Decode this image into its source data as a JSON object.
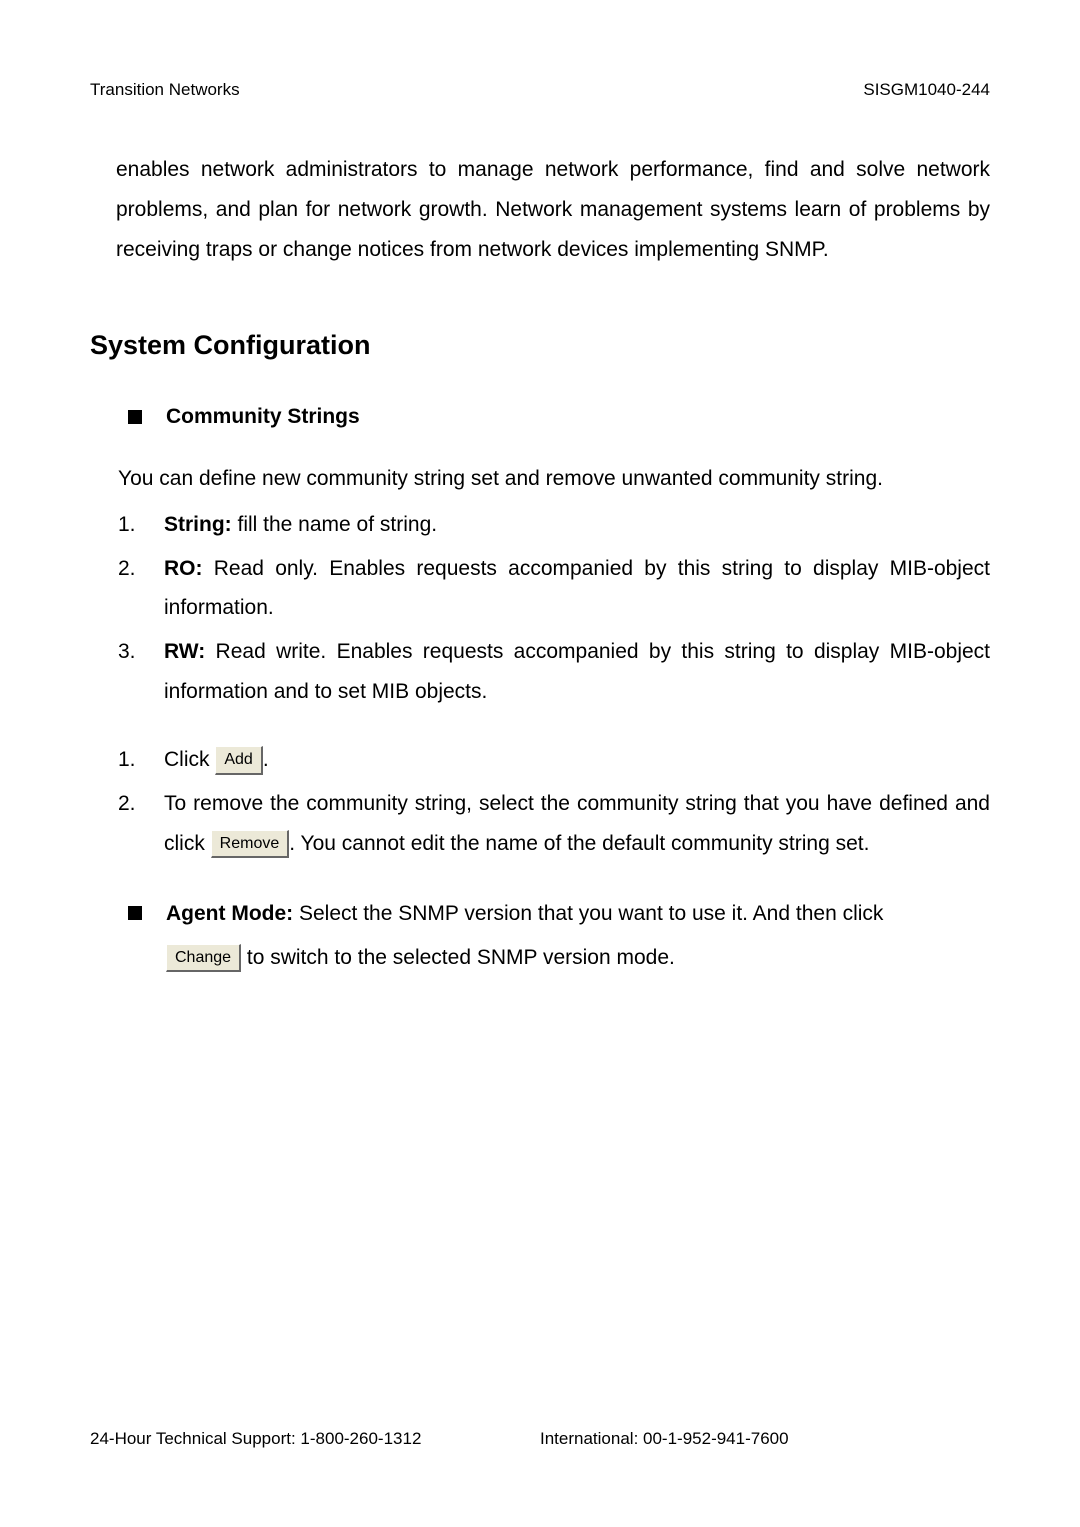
{
  "header": {
    "left": "Transition Networks",
    "right": "SISGM1040-244"
  },
  "intro": "enables network administrators to manage network performance, find and solve network problems, and plan for network growth. Network management systems learn of problems by receiving traps or change notices from network devices implementing SNMP.",
  "sectionTitle": "System Configuration",
  "communityHeading": "Community Strings",
  "communityLead": "You can define new community string set and remove unwanted community string.",
  "defs": [
    {
      "num": "1.",
      "label": "String:",
      "text": " fill the name of string."
    },
    {
      "num": "2.",
      "label": "RO:",
      "text": " Read only. Enables requests accompanied by this string to display MIB-object information."
    },
    {
      "num": "3.",
      "label": "RW:",
      "text": " Read write. Enables requests accompanied by this string to display MIB-object information and to set MIB objects."
    }
  ],
  "steps": {
    "s1": {
      "num": "1.",
      "pre": "Click ",
      "btn": "Add",
      "post": "."
    },
    "s2": {
      "num": "2.",
      "pre": "To remove the community string, select the community string that you have defined and click ",
      "btn": "Remove",
      "post": ". You cannot edit the name of the default community string set."
    }
  },
  "agent": {
    "label": "Agent Mode:",
    "line1rest": " Select the SNMP version that you want to use it. And then click",
    "btn": "Change",
    "line2rest": " to switch to the selected SNMP version mode."
  },
  "footer": {
    "left": "24-Hour Technical Support: 1-800-260-1312",
    "right": "International: 00-1-952-941-7600"
  }
}
